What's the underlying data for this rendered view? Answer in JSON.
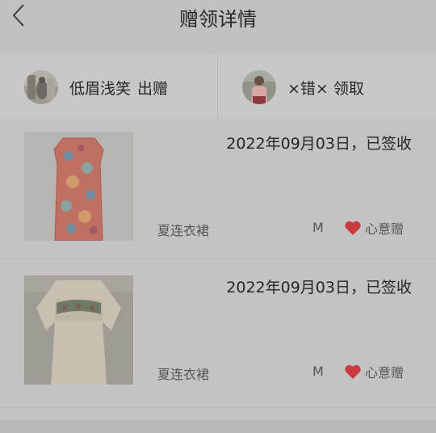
{
  "header": {
    "title": "赠领详情"
  },
  "parties": {
    "giver": {
      "name": "低眉浅笑",
      "action": "出赠"
    },
    "receiver": {
      "name": "×错×",
      "action": "领取"
    }
  },
  "items": [
    {
      "date_status": "2022年09月03日，已签收",
      "category": "夏连衣裙",
      "size": "M",
      "gift_label": "心意赠"
    },
    {
      "date_status": "2022年09月03日，已签收",
      "category": "夏连衣裙",
      "size": "M",
      "gift_label": "心意赠"
    }
  ],
  "colors": {
    "heart": "#cc3a40",
    "background": "#c3c3c3"
  }
}
